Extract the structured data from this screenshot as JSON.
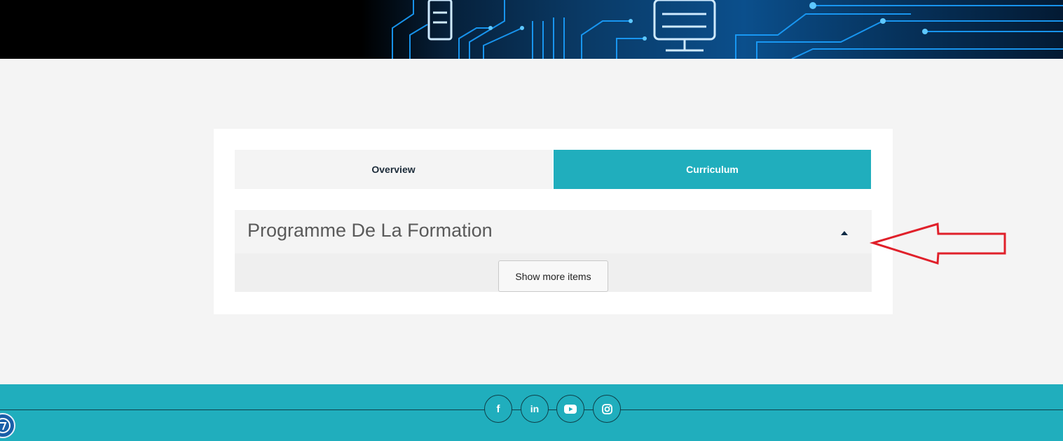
{
  "tabs": {
    "overview_label": "Overview",
    "curriculum_label": "Curriculum",
    "active": "Curriculum"
  },
  "accordion": {
    "title": "Programme De La Formation",
    "expanded": true,
    "show_more_label": "Show more items"
  },
  "footer": {
    "social_icons": [
      "facebook-icon",
      "linkedin-icon",
      "youtube-icon",
      "instagram-icon"
    ],
    "facebook_glyph": "f",
    "linkedin_glyph": "in"
  },
  "colors": {
    "accent": "#20aebd",
    "annotation_arrow": "#e0202a",
    "page_background": "#f4f4f4"
  }
}
